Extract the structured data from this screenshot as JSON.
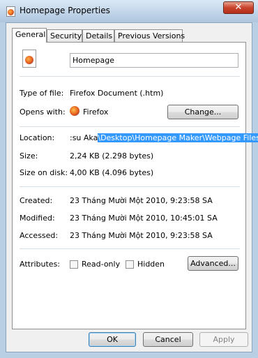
{
  "window": {
    "title": "Homepage Properties",
    "close_glyph": "✕"
  },
  "tabs": [
    "General",
    "Security",
    "Details",
    "Previous Versions"
  ],
  "general": {
    "file_name": "Homepage",
    "type_label": "Type of file:",
    "type_value": "Firefox Document (.htm)",
    "opens_label": "Opens with:",
    "opens_value": "Firefox",
    "change_button": "Change...",
    "location_label": "Location:",
    "location_prefix": ":su Aka",
    "location_selected": "\\Desktop\\Homepage Maker\\Webpage Files",
    "size_label": "Size:",
    "size_value": "2,24 KB (2.298 bytes)",
    "size_disk_label": "Size on disk:",
    "size_disk_value": "4,00 KB (4.096 bytes)",
    "created_label": "Created:",
    "created_value": "23 Tháng Mười Một 2010, 9:23:58 SA",
    "modified_label": "Modified:",
    "modified_value": "23 Tháng Mười Một 2010, 10:45:01 SA",
    "accessed_label": "Accessed:",
    "accessed_value": "23 Tháng Mười Một 2010, 9:23:58 SA",
    "attributes_label": "Attributes:",
    "readonly_label": "Read-only",
    "hidden_label": "Hidden",
    "advanced_button": "Advanced..."
  },
  "buttons": {
    "ok": "OK",
    "cancel": "Cancel",
    "apply": "Apply"
  },
  "colors": {
    "selection": "#3399ff",
    "accent": "#3c7fb1"
  }
}
